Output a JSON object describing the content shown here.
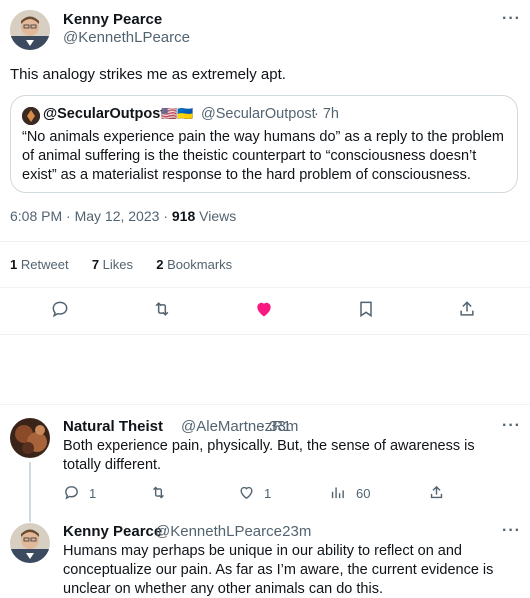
{
  "main_tweet": {
    "author_name": "Kenny Pearce",
    "author_handle": "@KennethLPearce",
    "text": "This analogy strikes me as extremely apt.",
    "timestamp": "6:08 PM · May 12, 2023",
    "views_count": "918",
    "views_label": "Views",
    "more_icon": "more-dots-icon"
  },
  "quoted_tweet": {
    "author_name": "@SecularOutpost",
    "flags": "🇺🇸🇺🇦",
    "author_handle": "@SecularOutpost",
    "time": "· 7h",
    "text": "“No animals experience pain the way humans do” as a reply to the problem of animal suffering is the theistic counterpart to “consciousness doesn’t exist” as a materialist response to the hard problem of consciousness."
  },
  "stats": {
    "retweets_count": "1",
    "retweets_label": "Retweet",
    "likes_count": "7",
    "likes_label": "Likes",
    "bookmarks_count": "2",
    "bookmarks_label": "Bookmarks"
  },
  "actions": {
    "reply_icon": "reply-icon",
    "retweet_icon": "retweet-icon",
    "like_icon": "heart-filled-icon",
    "bookmark_icon": "bookmark-icon",
    "share_icon": "share-icon",
    "like_color": "#f91880"
  },
  "replies": [
    {
      "author_name": "Natural Theist",
      "author_handle": "@AleMartnezR1",
      "time": "· 33m",
      "text": "Both experience pain, physically. But, the sense of awareness is totally different.",
      "reply_count": "1",
      "retweet_count": "",
      "like_count": "1",
      "views_count": "60"
    },
    {
      "author_name": "Kenny Pearce",
      "author_handle": "@KennethLPearce",
      "time": "· 23m",
      "text": "Humans may perhaps be unique in our ability to reflect on and conceptualize our pain. As far as I’m aware, the current evidence is unclear on whether any other animals can do this."
    }
  ],
  "colors": {
    "text_primary": "#0f1419",
    "text_secondary": "#536471",
    "border": "#eff3f4",
    "quote_border": "#cfd9de"
  }
}
